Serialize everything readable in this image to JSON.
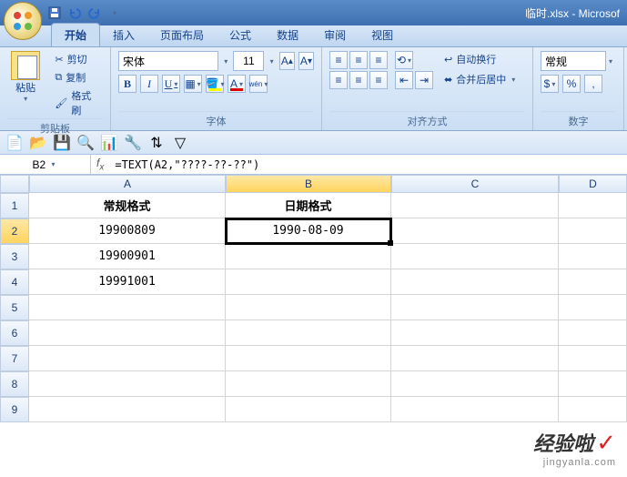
{
  "window": {
    "title": "临时.xlsx - Microsof"
  },
  "tabs": {
    "home": "开始",
    "insert": "插入",
    "layout": "页面布局",
    "formulas": "公式",
    "data": "数据",
    "review": "审阅",
    "view": "视图"
  },
  "ribbon": {
    "clipboard": {
      "paste": "粘贴",
      "cut": "剪切",
      "copy": "复制",
      "painter": "格式刷",
      "label": "剪贴板"
    },
    "font": {
      "name": "宋体",
      "size": "11",
      "label": "字体"
    },
    "align": {
      "wrap": "自动换行",
      "merge": "合并后居中",
      "label": "对齐方式"
    },
    "number": {
      "format": "常规",
      "label": "数字"
    }
  },
  "namebox": "B2",
  "formula": "=TEXT(A2,\"????-??-??\")",
  "cols": [
    "A",
    "B",
    "C",
    "D"
  ],
  "rows": [
    "1",
    "2",
    "3",
    "4",
    "5",
    "6",
    "7",
    "8",
    "9"
  ],
  "data": {
    "A1": "常规格式",
    "B1": "日期格式",
    "A2": "19900809",
    "B2": "1990-08-09",
    "A3": "19900901",
    "A4": "19991001"
  },
  "watermark": {
    "main": "经验啦",
    "sub": "jingyanla.com"
  }
}
